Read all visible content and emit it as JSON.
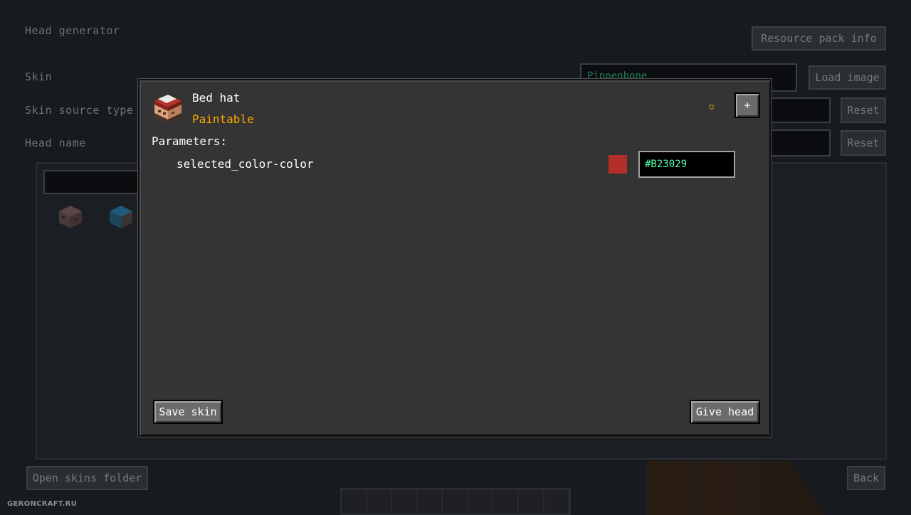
{
  "background": {
    "title": "Head generator",
    "resource_pack_button": "Resource pack info",
    "skin_label": "Skin",
    "skin_value": "Pippenbone",
    "load_image_button": "Load image",
    "skin_source_label": "Skin source type",
    "reset_label": "Reset",
    "head_name_label": "Head name",
    "open_folder_button": "Open skins folder",
    "back_button": "Back",
    "watermark": "GERONCRAFT.RU"
  },
  "dialog": {
    "title": "Bed hat",
    "subtitle": "Paintable",
    "star_glyph": "✩",
    "add_glyph": "+",
    "parameters_label": "Parameters:",
    "param_name": "selected_color-color",
    "param_value": "#B23029",
    "swatch_color": "#B23029",
    "save_button": "Save skin",
    "give_button": "Give head"
  },
  "icons": {
    "head_icon": "bed-hat-head-icon",
    "star_icon": "star-icon"
  }
}
